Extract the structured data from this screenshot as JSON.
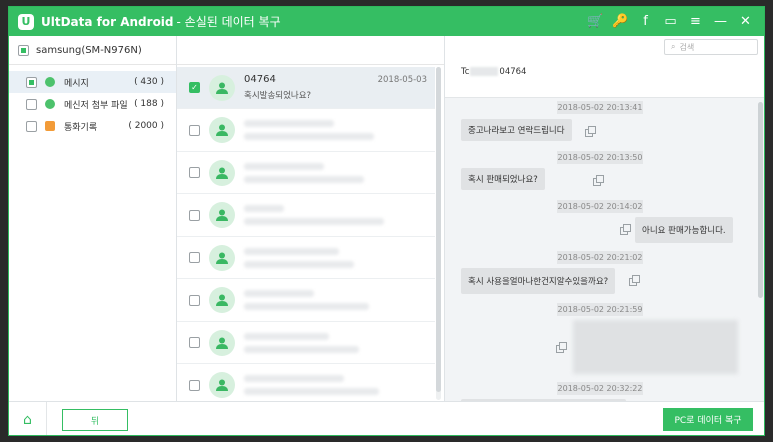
{
  "app": {
    "title": "UltData for Android",
    "subtitle": "- 손실된 데이터 복구",
    "logo_letter": "U"
  },
  "titlebar_icons": [
    "cart-icon",
    "key-icon",
    "facebook-icon",
    "feedback-icon",
    "menu-icon",
    "minimize-icon",
    "close-icon"
  ],
  "titlebar_glyphs": [
    "🛒",
    "🔑",
    "f",
    "▭",
    "≡",
    "—",
    "✕"
  ],
  "device": {
    "name": "samsung(SM-N976N)"
  },
  "categories": [
    {
      "label": "메시지",
      "count": "( 430 )"
    },
    {
      "label": "메신저 첨부 파일",
      "count": "( 188 )"
    },
    {
      "label": "통화기록",
      "count": "( 2000 )"
    }
  ],
  "messages": [
    {
      "name": "04764",
      "preview": "혹시발송되었나요?",
      "date": "2018-05-03"
    }
  ],
  "search": {
    "placeholder": "검색"
  },
  "contact": {
    "label": "Tc",
    "number": "04764"
  },
  "chat": {
    "timestamps": [
      "2018-05-02 20:13:41",
      "2018-05-02 20:13:50",
      "2018-05-02 20:14:02",
      "2018-05-02 20:21:02",
      "2018-05-02 20:21:59",
      "2018-05-02 20:32:22"
    ],
    "bubbles": [
      "중고나라보고 연락드립니다",
      "혹시 판매되었나요?",
      "아니요 판매가능합니다.",
      "혹시 사용을얼마나한건지알수있을까요?"
    ]
  },
  "bottom": {
    "back_label": "뒤",
    "recover_label": "PC로 데이터 복구"
  },
  "colors": {
    "accent": "#35be63",
    "cart": "#ffd633"
  }
}
